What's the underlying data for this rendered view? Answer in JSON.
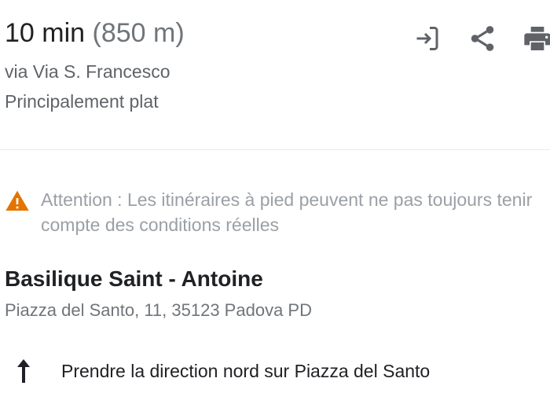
{
  "summary": {
    "duration": "10 min",
    "distance": "(850 m)",
    "via": "via Via S. Francesco",
    "terrain": "Principalement plat"
  },
  "actions": [
    {
      "icon": "send-to-device-icon"
    },
    {
      "icon": "share-icon"
    },
    {
      "icon": "print-icon"
    }
  ],
  "warning": {
    "icon": "warning-triangle-icon",
    "text": "Attention : Les itinéraires à pied peuvent ne pas toujours tenir compte des conditions réelles"
  },
  "destination": {
    "name": "Basilique Saint - Antoine",
    "address": "Piazza del Santo, 11, 35123 Padova PD"
  },
  "steps": [
    {
      "icon": "arrow-straight-up-icon",
      "text": "Prendre la direction nord sur Piazza del Santo"
    }
  ],
  "colors": {
    "primary_text": "#202124",
    "secondary_text": "#5f6368",
    "muted_text": "#70757a",
    "warning_text": "#9aa0a6",
    "warning_icon": "#e37400",
    "icon_gray": "#5f6368"
  }
}
